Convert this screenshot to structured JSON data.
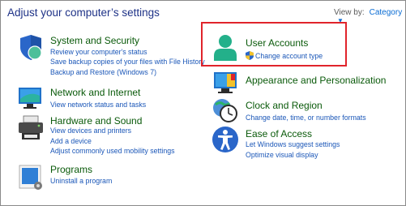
{
  "header": {
    "title": "Adjust your computer’s settings",
    "view_by_label": "View by:",
    "view_by_value": "Category"
  },
  "categories": [
    {
      "title": "System and Security",
      "icon": "shield-icon",
      "links": [
        "Review your computer's status",
        "Save backup copies of your files with File History",
        "Backup and Restore (Windows 7)"
      ]
    },
    {
      "title": "Network and Internet",
      "icon": "network-icon",
      "links": [
        "View network status and tasks"
      ]
    },
    {
      "title": "Hardware and Sound",
      "icon": "printer-icon",
      "links": [
        "View devices and printers",
        "Add a device",
        "Adjust commonly used mobility settings"
      ]
    },
    {
      "title": "Programs",
      "icon": "programs-icon",
      "links": [
        "Uninstall a program"
      ]
    },
    {
      "title": "User Accounts",
      "icon": "user-icon",
      "links": [
        "Change account type"
      ],
      "highlighted": true
    },
    {
      "title": "Appearance and Personalization",
      "icon": "appearance-icon",
      "links": []
    },
    {
      "title": "Clock and Region",
      "icon": "clock-icon",
      "links": [
        "Change date, time, or number formats"
      ]
    },
    {
      "title": "Ease of Access",
      "icon": "accessibility-icon",
      "links": [
        "Let Windows suggest settings",
        "Optimize visual display"
      ]
    }
  ],
  "colors": {
    "title_green": "#0a5a0a",
    "link_blue": "#1b57b8",
    "header_blue": "#1e3287",
    "highlight_red": "#e0242b"
  }
}
